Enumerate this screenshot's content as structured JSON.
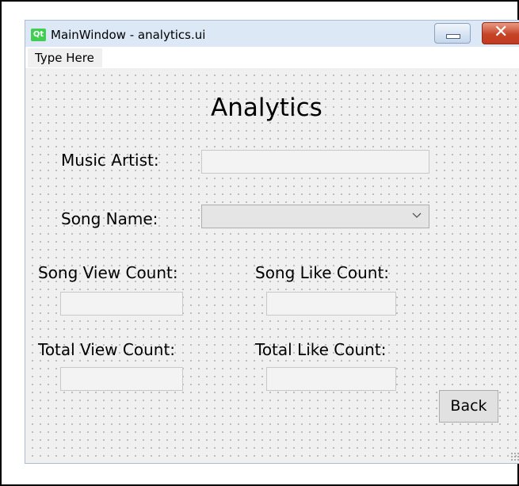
{
  "window": {
    "title": "MainWindow - analytics.ui",
    "logo_text": "Qt",
    "minimize_icon": "minimize-icon",
    "close_icon": "close-icon"
  },
  "menubar": {
    "items": [
      {
        "label": "Type Here"
      }
    ]
  },
  "form": {
    "heading": "Analytics",
    "music_artist_label": "Music Artist:",
    "music_artist_value": "",
    "song_name_label": "Song Name:",
    "song_name_selected": "",
    "song_name_chevron_icon": "chevron-down-icon",
    "song_view_count_label": "Song View Count:",
    "song_view_count_value": "",
    "song_like_count_label": "Song Like Count:",
    "song_like_count_value": "",
    "total_view_count_label": "Total View Count:",
    "total_view_count_value": "",
    "total_like_count_label": "Total Like Count:",
    "total_like_count_value": "",
    "back_label": "Back"
  }
}
